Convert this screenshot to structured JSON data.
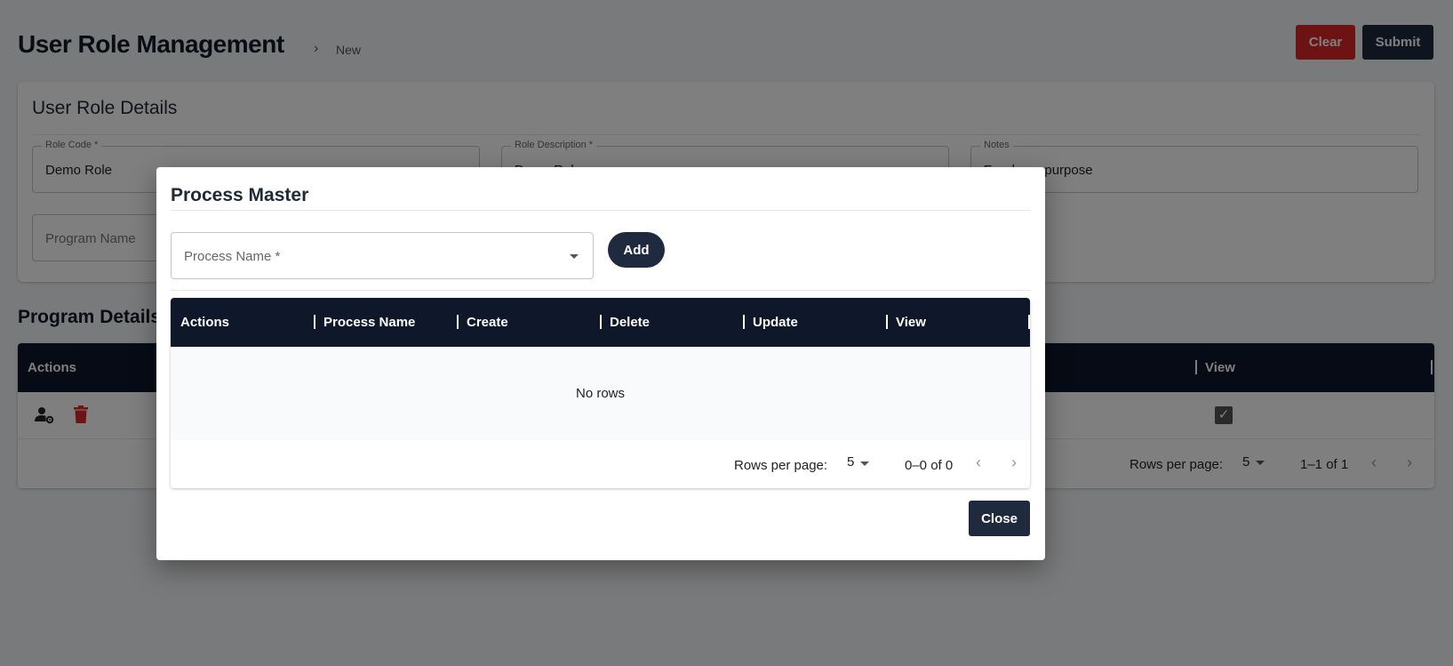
{
  "page": {
    "title": "User Role Management",
    "breadcrumb_current": "New",
    "clear_label": "Clear",
    "submit_label": "Submit"
  },
  "details": {
    "title": "User Role Details",
    "fields": {
      "role_code": {
        "label": "Role Code *",
        "value": "Demo Role"
      },
      "role_description": {
        "label": "Role Description *",
        "value": "Demo Role"
      },
      "notes": {
        "label": "Notes",
        "value": "For demo purpose"
      },
      "program_name": {
        "placeholder": "Program Name"
      }
    }
  },
  "program_details": {
    "title": "Program Details",
    "columns": {
      "actions": "Actions",
      "view": "View"
    },
    "footer": {
      "rows_per_page_label": "Rows per page:",
      "rows_per_page": "5",
      "range": "1–1 of 1"
    }
  },
  "modal": {
    "title": "Process Master",
    "process_name_placeholder": "Process Name *",
    "add_label": "Add",
    "columns": [
      "Actions",
      "Process Name",
      "Create",
      "Delete",
      "Update",
      "View"
    ],
    "empty_text": "No rows",
    "footer": {
      "rows_per_page_label": "Rows per page:",
      "rows_per_page": "5",
      "range": "0–0 of 0"
    },
    "close_label": "Close"
  },
  "colors": {
    "danger": "#dc2626",
    "primary": "#1f2a3f",
    "header": "#0f172a"
  }
}
